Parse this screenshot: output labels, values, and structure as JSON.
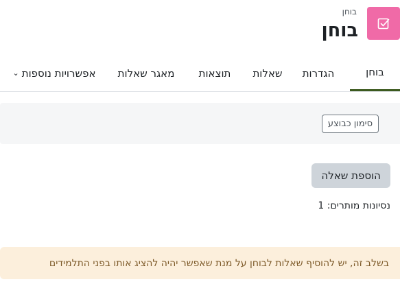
{
  "header": {
    "pretitle": "בוחן",
    "title": "בוחן",
    "icon": "checkbox-icon",
    "icon_color": "#f06aa7"
  },
  "tabs": [
    {
      "label": "בוחן",
      "active": true
    },
    {
      "label": "הגדרות",
      "active": false
    },
    {
      "label": "שאלות",
      "active": false
    },
    {
      "label": "תוצאות",
      "active": false
    },
    {
      "label": "מאגר שאלות",
      "active": false
    },
    {
      "label": "אפשרויות נוספות",
      "active": false,
      "has_dropdown": true
    }
  ],
  "actions": {
    "mark_done": "סימון כבוצע"
  },
  "main": {
    "add_question": "הוספת שאלה",
    "attempts": "נסיונות מותרים: 1",
    "notice": "בשלב זה, יש להוסיף שאלות לבוחן על מנת שאפשר יהיה להציג אותו בפני התלמידים"
  },
  "colors": {
    "active_tab_underline": "#3c5a1e",
    "notice_bg": "#fcefdc",
    "notice_text": "#7d5a29"
  }
}
